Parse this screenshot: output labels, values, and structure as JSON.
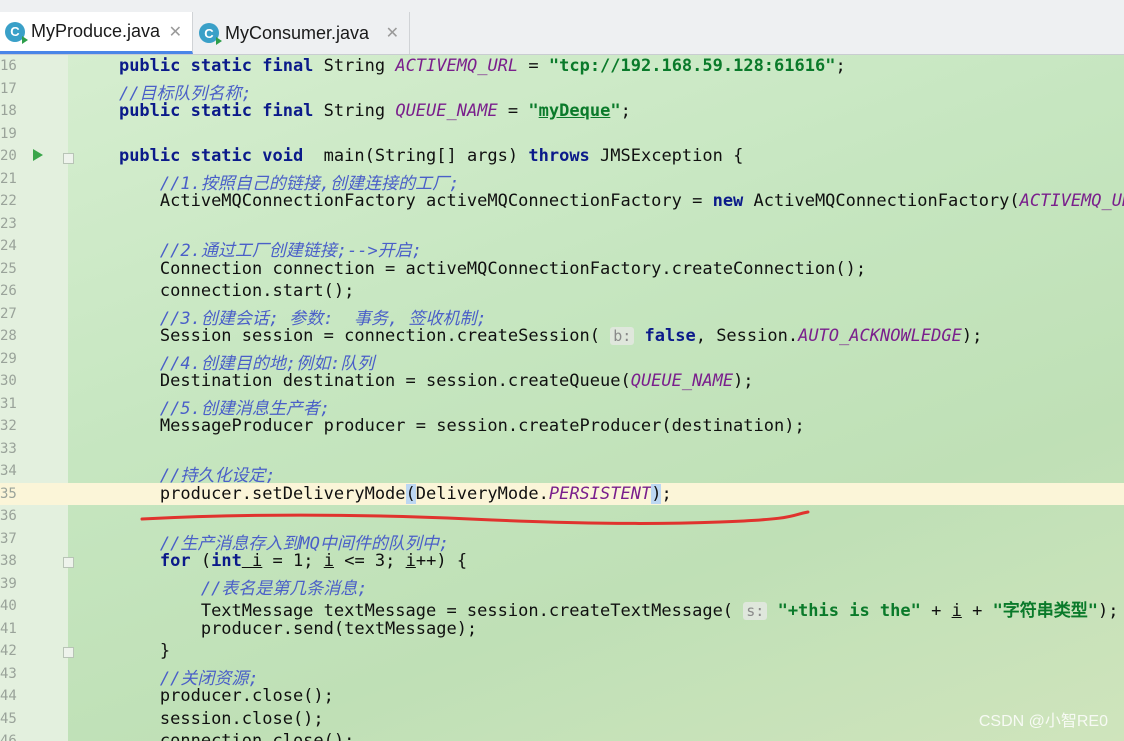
{
  "tabs": [
    {
      "icon": "C",
      "label": "MyProduce.java",
      "close": "✕"
    },
    {
      "icon": "C",
      "label": "MyConsumer.java",
      "close": "✕"
    }
  ],
  "lines": [
    {
      "n": "16",
      "tokens": [
        [
          "kw",
          "public static final"
        ],
        [
          "",
          "String "
        ],
        [
          "cn",
          "ACTIVEMQ_URL"
        ],
        [
          "",
          " = "
        ],
        [
          "st",
          "\"tcp://192.168.59.128:61616\""
        ],
        [
          "",
          ";"
        ]
      ],
      "indent": "    "
    },
    {
      "n": "17",
      "tokens": [
        [
          "cm",
          "//目标队列名称;"
        ]
      ],
      "indent": "    "
    },
    {
      "n": "18",
      "tokens": [
        [
          "kw",
          "public static final"
        ],
        [
          "",
          "String "
        ],
        [
          "cn",
          "QUEUE_NAME"
        ],
        [
          "",
          " = "
        ],
        [
          "st",
          "\""
        ],
        [
          "st ul",
          "myDeque"
        ],
        [
          "st",
          "\""
        ],
        [
          "",
          ";"
        ]
      ],
      "indent": "    "
    },
    {
      "n": "19",
      "tokens": [],
      "indent": ""
    },
    {
      "n": "20",
      "tokens": [
        [
          "kw",
          "public static void"
        ],
        [
          "",
          " main(String[] args) "
        ],
        [
          "kw",
          "throws"
        ],
        [
          "",
          " JMSException {"
        ]
      ],
      "indent": "    "
    },
    {
      "n": "21",
      "tokens": [
        [
          "cm",
          "//1.按照自己的链接,创建连接的工厂;"
        ]
      ],
      "indent": "        "
    },
    {
      "n": "22",
      "tokens": [
        [
          "",
          "ActiveMQConnectionFactory activeMQConnectionFactory = "
        ],
        [
          "kw",
          "new"
        ],
        [
          "",
          " ActiveMQConnectionFactory("
        ],
        [
          "cn",
          "ACTIVEMQ_URL"
        ],
        [
          "",
          ");"
        ]
      ],
      "indent": "        "
    },
    {
      "n": "23",
      "tokens": [],
      "indent": ""
    },
    {
      "n": "24",
      "tokens": [
        [
          "cm",
          "//2.通过工厂创建链接;-->开启;"
        ]
      ],
      "indent": "        "
    },
    {
      "n": "25",
      "tokens": [
        [
          "",
          "Connection connection = activeMQConnectionFactory.createConnection();"
        ]
      ],
      "indent": "        "
    },
    {
      "n": "26",
      "tokens": [
        [
          "",
          "connection.start();"
        ]
      ],
      "indent": "        "
    },
    {
      "n": "27",
      "tokens": [
        [
          "cm",
          "//3.创建会话; 参数:  事务, 签收机制;"
        ]
      ],
      "indent": "        "
    },
    {
      "n": "28",
      "tokens": [
        [
          "",
          "Session session = connection.createSession( "
        ],
        [
          "hint",
          "b:"
        ],
        [
          "kw",
          " false"
        ],
        [
          "",
          ", Session."
        ],
        [
          "cn",
          "AUTO_ACKNOWLEDGE"
        ],
        [
          "",
          ");"
        ]
      ],
      "indent": "        "
    },
    {
      "n": "29",
      "tokens": [
        [
          "cm",
          "//4.创建目的地;例如:队列"
        ]
      ],
      "indent": "        "
    },
    {
      "n": "30",
      "tokens": [
        [
          "",
          "Destination destination = session.createQueue("
        ],
        [
          "cn",
          "QUEUE_NAME"
        ],
        [
          "",
          ");"
        ]
      ],
      "indent": "        "
    },
    {
      "n": "31",
      "tokens": [
        [
          "cm",
          "//5.创建消息生产者;"
        ]
      ],
      "indent": "        "
    },
    {
      "n": "32",
      "tokens": [
        [
          "",
          "MessageProducer producer = session.createProducer(destination);"
        ]
      ],
      "indent": "        "
    },
    {
      "n": "33",
      "tokens": [],
      "indent": ""
    },
    {
      "n": "34",
      "tokens": [
        [
          "cm",
          "//持久化设定;"
        ]
      ],
      "indent": "        "
    },
    {
      "n": "35",
      "tokens": [
        [
          "",
          "producer.setDeliveryMode"
        ],
        [
          "paren-hl",
          "("
        ],
        [
          "",
          "DeliveryMode."
        ],
        [
          "cn",
          "PERSISTENT"
        ],
        [
          "paren-hl",
          ")"
        ],
        [
          "",
          ";"
        ]
      ],
      "indent": "        ",
      "current": true
    },
    {
      "n": "36",
      "tokens": [],
      "indent": ""
    },
    {
      "n": "37",
      "tokens": [
        [
          "cm",
          "//生产消息存入到MQ中间件的队列中;"
        ]
      ],
      "indent": "        "
    },
    {
      "n": "38",
      "tokens": [
        [
          "kw",
          "for"
        ],
        [
          "",
          " ("
        ],
        [
          "kw",
          "int"
        ],
        [
          " ul",
          " i"
        ],
        [
          "",
          " = 1; "
        ],
        [
          "ul",
          "i"
        ],
        [
          "",
          " <= 3; "
        ],
        [
          "ul",
          "i"
        ],
        [
          "",
          "++) {"
        ]
      ],
      "indent": "        "
    },
    {
      "n": "39",
      "tokens": [
        [
          "cm",
          "//表名是第几条消息;"
        ]
      ],
      "indent": "            "
    },
    {
      "n": "40",
      "tokens": [
        [
          "",
          "TextMessage textMessage = session.createTextMessage( "
        ],
        [
          "hint",
          "s:"
        ],
        [
          "st",
          " \"+this is the\""
        ],
        [
          "",
          " + "
        ],
        [
          "ul",
          "i"
        ],
        [
          "",
          " + "
        ],
        [
          "st",
          "\"字符串类型\""
        ],
        [
          "",
          ");"
        ]
      ],
      "indent": "            "
    },
    {
      "n": "41",
      "tokens": [
        [
          "",
          "producer.send(textMessage);"
        ]
      ],
      "indent": "            "
    },
    {
      "n": "42",
      "tokens": [
        [
          "",
          "}"
        ]
      ],
      "indent": "        "
    },
    {
      "n": "43",
      "tokens": [
        [
          "cm",
          "//关闭资源;"
        ]
      ],
      "indent": "        "
    },
    {
      "n": "44",
      "tokens": [
        [
          "",
          "producer.close();"
        ]
      ],
      "indent": "        "
    },
    {
      "n": "45",
      "tokens": [
        [
          "",
          "session.close();"
        ]
      ],
      "indent": "        "
    },
    {
      "n": "46",
      "tokens": [
        [
          "",
          "connection.close();"
        ]
      ],
      "indent": "        "
    }
  ],
  "watermark": "CSDN @小智RE0",
  "colors": {
    "annotation_red": "#e0332e",
    "run_green": "#3aa64a",
    "tab_accent": "#4a86e8"
  }
}
